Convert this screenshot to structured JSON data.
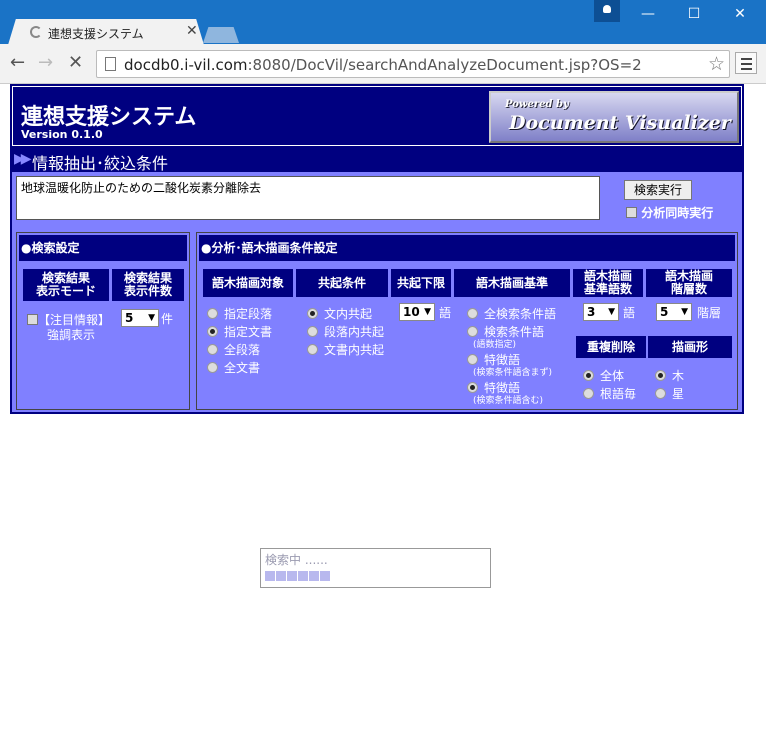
{
  "browser": {
    "tab_title": "連想支援システム",
    "url_host": "docdb0.i-vil.com",
    "url_rest": ":8080/DocVil/searchAndAnalyzeDocument.jsp?OS=2"
  },
  "app": {
    "title": "連想支援システム",
    "version": "Version 0.1.0",
    "logo_small": "Powered by",
    "logo_big": "Document Visualizer",
    "section_title": "情報抽出･絞込条件",
    "query": "地球温暖化防止のための二酸化炭素分離除去",
    "run_button": "検索実行",
    "simultaneous_analysis": "分析同時実行"
  },
  "search_settings": {
    "title": "●検索設定",
    "col1": "検索結果\n表示モード",
    "col2": "検索結果\n表示件数",
    "highlight_option": "【注目情報】",
    "highlight_option2": "強調表示",
    "count_value": "5",
    "count_unit": "件"
  },
  "analysis": {
    "title": "●分析･語木描画条件設定",
    "target_header": "語木描画対象",
    "target_options": [
      "指定段落",
      "指定文書",
      "全段落",
      "全文書"
    ],
    "target_selected": 1,
    "cooc_header": "共起条件",
    "cooc_options": [
      "文内共起",
      "段落内共起",
      "文書内共起"
    ],
    "cooc_selected": 0,
    "lower_limit_header": "共起下限",
    "lower_limit_value": "10",
    "lower_limit_unit": "語",
    "criteria_header": "語木描画基準",
    "criteria_options": [
      "全検索条件語",
      "検索条件語",
      "特徴語",
      "特徴語"
    ],
    "criteria_subs": [
      "(語数指定)",
      "(検索条件語含まず)",
      "(検索条件語含む)"
    ],
    "criteria_selected": 3,
    "base_words_header": "語木描画\n基準語数",
    "base_words_value": "3",
    "base_words_unit": "語",
    "layers_header": "語木描画\n階層数",
    "layers_value": "5",
    "layers_unit": "階層",
    "dedup_header": "重複削除",
    "dedup_options": [
      "全体",
      "根語毎"
    ],
    "dedup_selected": 0,
    "shape_header": "描画形",
    "shape_options": [
      "木",
      "星"
    ],
    "shape_selected": 0
  },
  "status": {
    "text": "検索中 ......"
  }
}
